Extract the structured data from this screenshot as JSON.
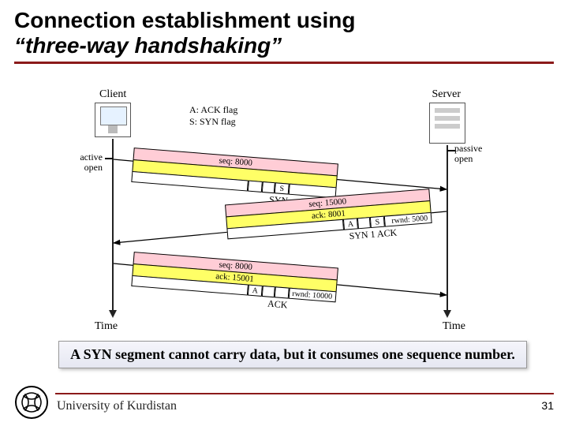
{
  "title": {
    "line1": "Connection establishment using",
    "line2": "“three-way handshaking”"
  },
  "diagram": {
    "endpoints": {
      "client": "Client",
      "server": "Server"
    },
    "legend": {
      "ack": "A: ACK flag",
      "syn": "S: SYN flag"
    },
    "side_labels": {
      "active_open": "active\nopen",
      "passive_open": "passive\nopen"
    },
    "time_label_left": "Time",
    "time_label_right": "Time",
    "segments": {
      "syn": {
        "seq": "seq: 8000",
        "flags": {
          "S": "S"
        },
        "caption": "SYN"
      },
      "synack": {
        "seq": "seq: 15000",
        "ack": "ack: 8001",
        "rwnd": "rwnd: 5000",
        "flags": {
          "A": "A",
          "S": "S"
        },
        "caption": "SYN 1 ACK"
      },
      "ack": {
        "seq": "seq: 8000",
        "ack": "ack: 15001",
        "rwnd": "rwnd: 10000",
        "flags": {
          "A": "A"
        },
        "caption": "ACK"
      }
    }
  },
  "note": "A SYN segment cannot carry data, but it consumes one sequence number.",
  "footer": {
    "org": "University of Kurdistan",
    "page": "31"
  }
}
